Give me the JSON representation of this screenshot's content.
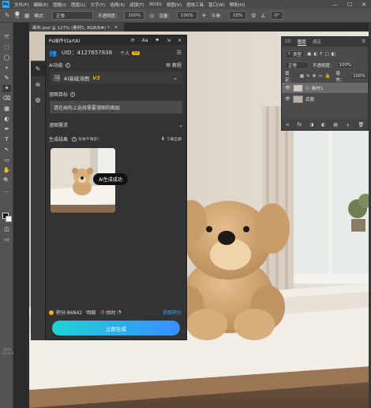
{
  "app": {
    "logo": "Ps",
    "menu": [
      "文件(F)",
      "编辑(E)",
      "图像(I)",
      "图层(L)",
      "文字(Y)",
      "选择(S)",
      "滤镜(T)",
      "3D(D)",
      "视图(V)",
      "增效工具",
      "窗口(W)",
      "帮助(H)"
    ],
    "window_controls": [
      "—",
      "☐",
      "✕"
    ]
  },
  "options_bar": {
    "brush_size": "31",
    "mode_label": "模式：",
    "mode_value": "正常",
    "opacity_label": "不透明度：",
    "opacity_value": "100%",
    "flow_label": "流量：",
    "flow_value": "100%",
    "smooth_label": "平滑：",
    "smooth_value": "10%",
    "angle_value": "0°"
  },
  "document": {
    "tab_title": "画布.psd @ 127% (素材1, RGB/8#) *",
    "tab_close": "×"
  },
  "toolbar": {
    "tools": [
      "⤧",
      "⬚",
      "◯",
      "⌖",
      "✎",
      "✦",
      "⌫",
      "▦",
      "◐",
      "✒",
      "T",
      "↖",
      "▭",
      "✋",
      "🔍",
      "…"
    ],
    "fg_color": "#000000",
    "bg_color": "#ffffff",
    "version_line1": "Beta",
    "version_line2": "V2.20.3"
  },
  "plugin": {
    "title": "Ps插件StartAI",
    "title_controls": [
      "⟳",
      "Aa",
      "⚑",
      "⇲",
      "✕"
    ],
    "uid_label": "UID：4127657838",
    "account_label": "个人",
    "account_version": "V2",
    "ai_function_label": "AI功能",
    "tutorial_label": "教程",
    "selected_function": "AI高级溶图",
    "selected_version": "V3",
    "target_label": "溶图目标",
    "target_placeholder": "请在画布上选择需要溶图的图层",
    "requirements_label": "溶图需求",
    "results_label": "生成结果",
    "unsatisfied_label": "效果不满意？",
    "download_all_label": "下载全部",
    "success_badge": "AI生成成功",
    "points_label": "积分:86842",
    "details_label": "明细",
    "estimate_label": "估时",
    "get_points_label": "获取积分",
    "generate_button": "立即生成",
    "strip_icons": [
      "brush-icon",
      "layers-icon",
      "gear-icon"
    ]
  },
  "layers_panel": {
    "tabs": [
      "3D",
      "图层",
      "通道"
    ],
    "kind_label": "类型",
    "blend_mode": "正常",
    "opacity_label": "不透明度：",
    "opacity_value": "100%",
    "lock_label": "锁定：",
    "fill_label": "填充：",
    "fill_value": "100%",
    "layers": [
      {
        "name": "素材1",
        "visible": true,
        "selected": true
      },
      {
        "name": "武器",
        "visible": true,
        "selected": false
      }
    ],
    "footer_icons": [
      "∞",
      "fx",
      "◑",
      "◐",
      "▤",
      "＋",
      "🗑"
    ]
  },
  "colors": {
    "accent_blue": "#31a8ff",
    "button_gradient_start": "#1fd3d4",
    "button_gradient_end": "#3a8dff",
    "version_badge": "#f5b400",
    "panel_bg": "#333333"
  }
}
